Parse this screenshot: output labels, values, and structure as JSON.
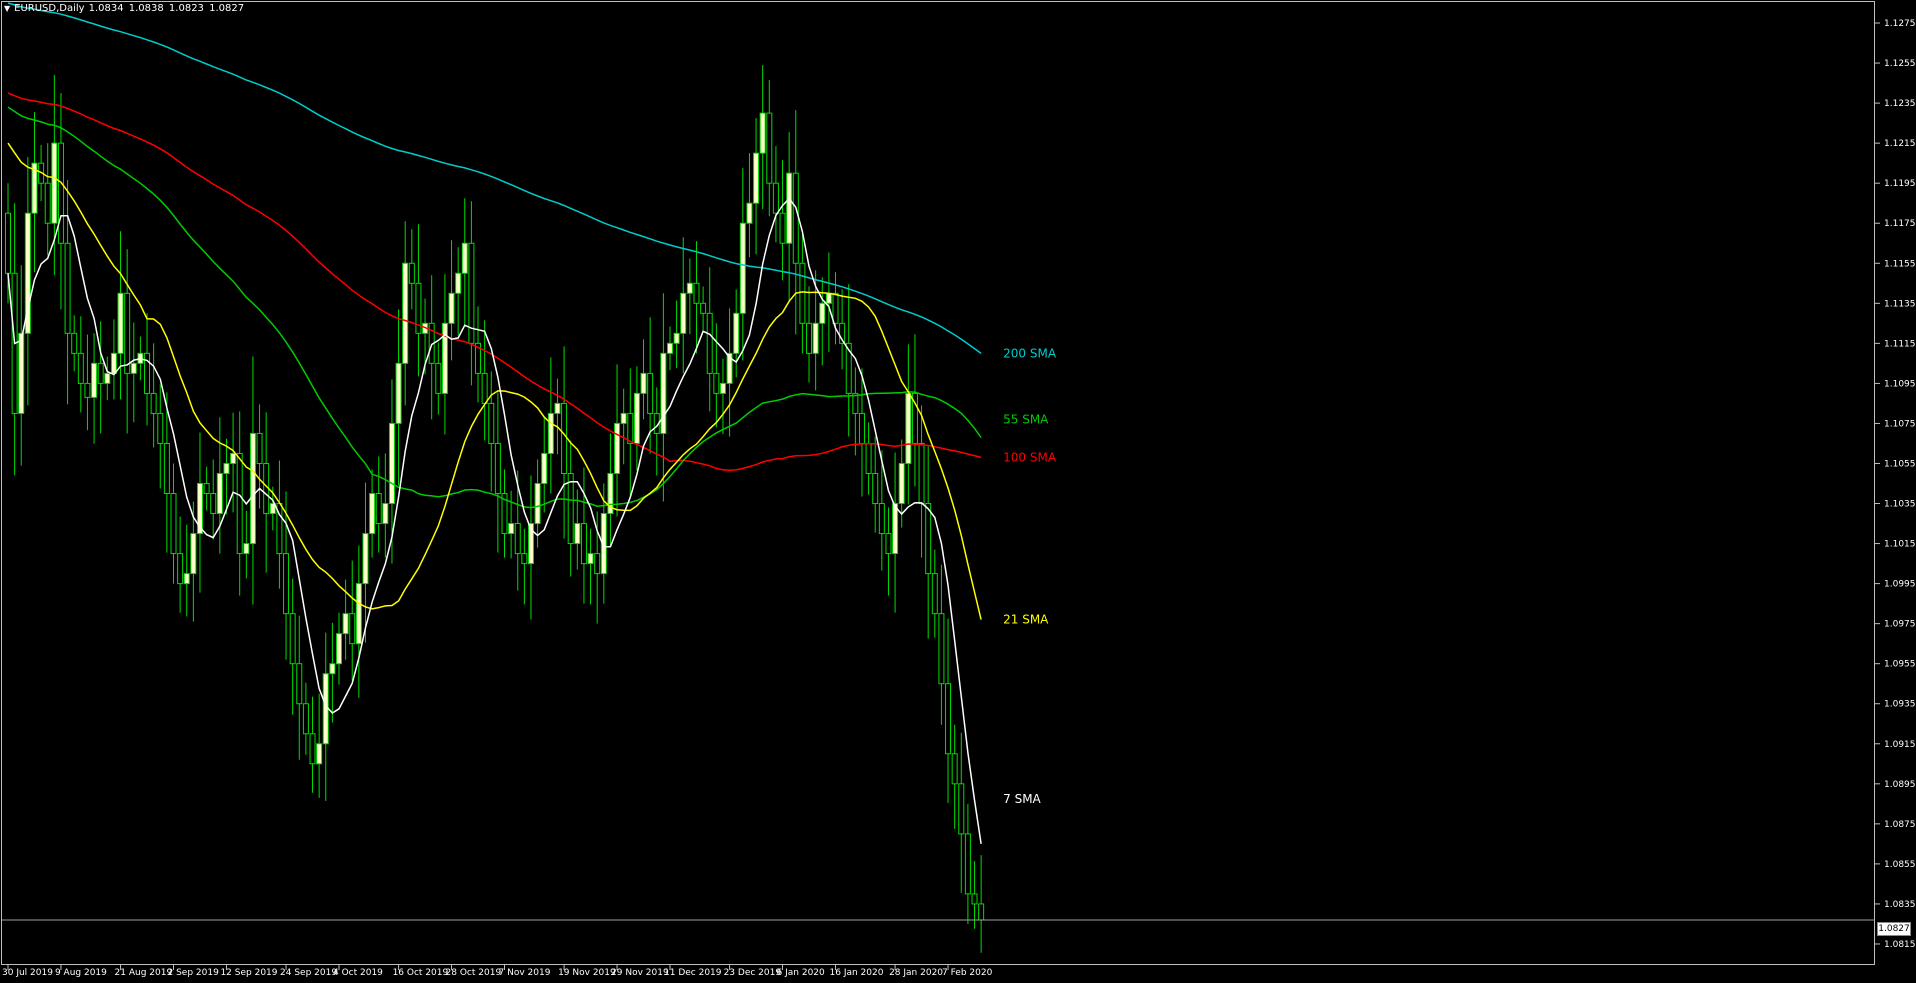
{
  "window": {
    "symbol_timeframe": "EURUSD,Daily",
    "ohlc": "1.0834 1.0838 1.0823 1.0827",
    "menu_arrow_icon": "triangle-down-icon"
  },
  "colors": {
    "background": "#000000",
    "frame": "#c0c0c0",
    "bull_candle": "#ffffcc",
    "bear_candle": "#000000",
    "candle_wick": "#00dd00",
    "sma7": "#ffffff",
    "sma21": "#ffff00",
    "sma55": "#00cc00",
    "sma100": "#ff0000",
    "sma200": "#00cccc",
    "bid_line": "#a0a0a0"
  },
  "chart_data": {
    "type": "candlestick",
    "symbol": "EURUSD",
    "timeframe": "Daily",
    "ylim": [
      1.0805,
      1.1285
    ],
    "y_ticks": [
      "1.1275",
      "1.1255",
      "1.1235",
      "1.1215",
      "1.1195",
      "1.1175",
      "1.1155",
      "1.1135",
      "1.1115",
      "1.1095",
      "1.1075",
      "1.1055",
      "1.1035",
      "1.1015",
      "1.0995",
      "1.0975",
      "1.0955",
      "1.0935",
      "1.0915",
      "1.0895",
      "1.0875",
      "1.0855",
      "1.0835",
      "1.0815"
    ],
    "x_ticks": [
      {
        "label": "30 Jul 2019",
        "bar": 0
      },
      {
        "label": "9 Aug 2019",
        "bar": 8
      },
      {
        "label": "21 Aug 2019",
        "bar": 17
      },
      {
        "label": "2 Sep 2019",
        "bar": 25
      },
      {
        "label": "12 Sep 2019",
        "bar": 33
      },
      {
        "label": "24 Sep 2019",
        "bar": 42
      },
      {
        "label": "4 Oct 2019",
        "bar": 50
      },
      {
        "label": "16 Oct 2019",
        "bar": 59
      },
      {
        "label": "28 Oct 2019",
        "bar": 67
      },
      {
        "label": "7 Nov 2019",
        "bar": 75
      },
      {
        "label": "19 Nov 2019",
        "bar": 84
      },
      {
        "label": "29 Nov 2019",
        "bar": 92
      },
      {
        "label": "11 Dec 2019",
        "bar": 100
      },
      {
        "label": "23 Dec 2019",
        "bar": 109
      },
      {
        "label": "6 Jan 2020",
        "bar": 117
      },
      {
        "label": "16 Jan 2020",
        "bar": 125
      },
      {
        "label": "28 Jan 2020",
        "bar": 134
      },
      {
        "label": "7 Feb 2020",
        "bar": 142
      }
    ],
    "closes": [
      1.115,
      1.108,
      1.112,
      1.118,
      1.1205,
      1.1195,
      1.1175,
      1.1215,
      1.1165,
      1.112,
      1.111,
      1.1095,
      1.1088,
      1.1105,
      1.1095,
      1.11,
      1.111,
      1.114,
      1.11,
      1.1105,
      1.111,
      1.109,
      1.108,
      1.1065,
      1.104,
      1.101,
      1.0995,
      1.1,
      1.102,
      1.1045,
      1.104,
      1.103,
      1.105,
      1.1055,
      1.106,
      1.101,
      1.1015,
      1.107,
      1.1055,
      1.103,
      1.1035,
      1.101,
      1.098,
      1.0955,
      1.0935,
      1.092,
      1.0905,
      1.0915,
      1.095,
      1.0955,
      1.097,
      1.098,
      1.0965,
      1.0995,
      1.102,
      1.104,
      1.1025,
      1.1035,
      1.1075,
      1.1105,
      1.1155,
      1.1145,
      1.112,
      1.1125,
      1.1105,
      1.109,
      1.1125,
      1.114,
      1.115,
      1.1165,
      1.1115,
      1.11,
      1.1085,
      1.1065,
      1.104,
      1.102,
      1.1025,
      1.101,
      1.1005,
      1.1025,
      1.1045,
      1.106,
      1.108,
      1.1085,
      1.105,
      1.1015,
      1.1025,
      1.1005,
      1.101,
      1.1,
      1.103,
      1.105,
      1.1075,
      1.108,
      1.1065,
      1.109,
      1.11,
      1.108,
      1.107,
      1.111,
      1.1115,
      1.112,
      1.114,
      1.1145,
      1.1135,
      1.113,
      1.11,
      1.109,
      1.1095,
      1.111,
      1.113,
      1.1175,
      1.1185,
      1.121,
      1.123,
      1.1195,
      1.118,
      1.1165,
      1.12,
      1.1155,
      1.1125,
      1.111,
      1.1125,
      1.1135,
      1.114,
      1.1125,
      1.1115,
      1.109,
      1.108,
      1.1065,
      1.105,
      1.1035,
      1.102,
      1.101,
      1.1035,
      1.1055,
      1.109,
      1.1065,
      1.1035,
      1.1,
      1.098,
      1.0945,
      1.091,
      1.0895,
      1.087,
      1.084,
      1.0835,
      1.0827
    ],
    "last_price": "1.0827",
    "indicators": [
      {
        "name": "7 SMA",
        "period": 7,
        "color": "#ffffff",
        "label": "7 SMA"
      },
      {
        "name": "21 SMA",
        "period": 21,
        "color": "#ffff00",
        "label": "21 SMA"
      },
      {
        "name": "55 SMA",
        "period": 55,
        "color": "#00cc00",
        "label": "55 SMA"
      },
      {
        "name": "100 SMA",
        "period": 100,
        "color": "#ff0000",
        "label": "100 SMA"
      },
      {
        "name": "200 SMA",
        "period": 200,
        "color": "#00cccc",
        "label": "200 SMA"
      }
    ],
    "indicator_end_values": {
      "7 SMA": 1.0865,
      "21 SMA": 1.0977,
      "55 SMA": 1.1068,
      "100 SMA": 1.1058,
      "200 SMA": 1.111
    },
    "indicator_start_values": {
      "21 SMA": 1.1215,
      "55 SMA": 1.1233,
      "100 SMA": 1.124,
      "200 SMA": 1.1285
    }
  }
}
